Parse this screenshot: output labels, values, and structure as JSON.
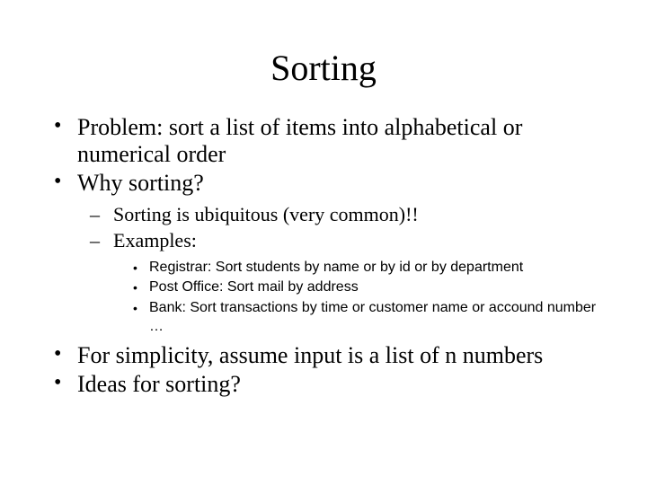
{
  "title": "Sorting",
  "bullets": {
    "b1": "Problem: sort a list of items into alphabetical or numerical order",
    "b2": "Why sorting?",
    "b2_1": "Sorting is ubiquitous (very common)!!",
    "b2_2": "Examples:",
    "b2_2_1": "Registrar: Sort students by name or  by id or by department",
    "b2_2_2": "Post Office: Sort mail by address",
    "b2_2_3": "Bank: Sort transactions by time or customer name or accound number …",
    "b3": "For simplicity, assume input is a list of n numbers",
    "b4": "Ideas for sorting?"
  }
}
